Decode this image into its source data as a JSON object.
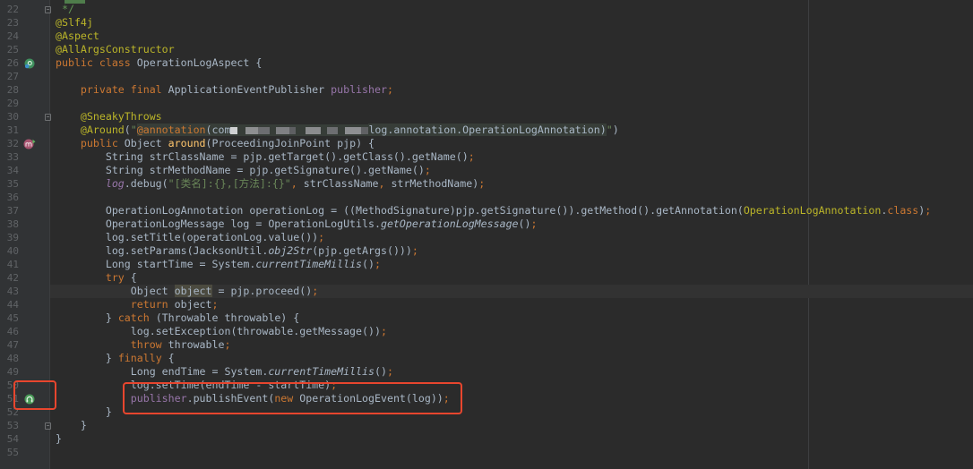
{
  "theme": {
    "bg": "#2B2B2B",
    "gutter_bg": "#313335",
    "text": "#A9B7C6",
    "keyword": "#CC7832",
    "annotation": "#BBB529",
    "string": "#6A8759",
    "field": "#9876AA",
    "method_decl": "#FFC66D",
    "javadoc": "#629755",
    "line_number": "#606366",
    "identifier_highlight": "#4B4A3F",
    "injection_bg": "#373D38",
    "caret_row": "#323232",
    "right_margin": "#3D3F41",
    "fold_marker": "#6E7072",
    "callout": "#E8462E"
  },
  "editor": {
    "caret_line": 43,
    "lines": [
      {
        "n": 22,
        "fold_end": true,
        "tokens": [
          {
            "doc": " */"
          }
        ]
      },
      {
        "n": 23,
        "tokens": [
          {
            "ann": "@Slf4j"
          }
        ]
      },
      {
        "n": 24,
        "tokens": [
          {
            "ann": "@Aspect"
          }
        ]
      },
      {
        "n": 25,
        "tokens": [
          {
            "ann": "@AllArgsConstructor"
          }
        ]
      },
      {
        "n": 26,
        "icon": "aspect-icon",
        "tokens": [
          {
            "kw": "public class "
          },
          {
            "d": "OperationLogAspect {"
          }
        ]
      },
      {
        "n": 27,
        "tokens": []
      },
      {
        "n": 28,
        "tokens": [
          {
            "kw": "    private final "
          },
          {
            "d": "ApplicationEventPublisher "
          },
          {
            "fld": "publisher"
          },
          {
            "kw": ";"
          }
        ]
      },
      {
        "n": 29,
        "tokens": []
      },
      {
        "n": 30,
        "fold_start": true,
        "tokens": [
          {
            "ann": "    @SneakyThrows"
          }
        ]
      },
      {
        "n": 31,
        "tokens": [
          {
            "ann": "    @Around"
          },
          {
            "d": "("
          },
          {
            "str": "\""
          },
          {
            "kw_inj": "@annotation"
          },
          {
            "inj": "(com"
          },
          {
            "redacted": true
          },
          {
            "inj": "log.annotation.OperationLogAnnotation)"
          },
          {
            "str": "\""
          },
          {
            "d": ")"
          }
        ]
      },
      {
        "n": 32,
        "icon": "advice-icon",
        "tokens": [
          {
            "kw": "    public "
          },
          {
            "d": "Object "
          },
          {
            "decl": "around"
          },
          {
            "d": "(ProceedingJoinPoint pjp) {"
          }
        ]
      },
      {
        "n": 33,
        "tokens": [
          {
            "d": "        String strClassName = pjp.getTarget().getClass().getName()"
          },
          {
            "kw": ";"
          }
        ]
      },
      {
        "n": 34,
        "tokens": [
          {
            "d": "        String strMethodName = pjp.getSignature().getName()"
          },
          {
            "kw": ";"
          }
        ]
      },
      {
        "n": 35,
        "tokens": [
          {
            "sfld": "        log"
          },
          {
            "d": ".debug("
          },
          {
            "str": "\"[类名]:{},[方法]:{}\""
          },
          {
            "kw": ", "
          },
          {
            "d": "strClassName"
          },
          {
            "kw": ", "
          },
          {
            "d": "strMethodName)"
          },
          {
            "kw": ";"
          }
        ]
      },
      {
        "n": 36,
        "tokens": []
      },
      {
        "n": 37,
        "tokens": [
          {
            "d": "        OperationLogAnnotation operationLog = ((MethodSignature)pjp.getSignature()).getMethod().getAnnotation("
          },
          {
            "ann": "OperationLogAnnotation"
          },
          {
            "d": "."
          },
          {
            "kw": "class"
          },
          {
            "d": ")"
          },
          {
            "kw": ";"
          }
        ]
      },
      {
        "n": 38,
        "tokens": [
          {
            "d": "        OperationLogMessage log = OperationLogUtils."
          },
          {
            "st": "getOperationLogMessage"
          },
          {
            "d": "()"
          },
          {
            "kw": ";"
          }
        ]
      },
      {
        "n": 39,
        "tokens": [
          {
            "d": "        log.setTitle(operationLog.value())"
          },
          {
            "kw": ";"
          }
        ]
      },
      {
        "n": 40,
        "tokens": [
          {
            "d": "        log.setParams(JacksonUtil."
          },
          {
            "st": "obj2Str"
          },
          {
            "d": "(pjp.getArgs()))"
          },
          {
            "kw": ";"
          }
        ]
      },
      {
        "n": 41,
        "tokens": [
          {
            "d": "        Long startTime = System."
          },
          {
            "st": "currentTimeMillis"
          },
          {
            "d": "()"
          },
          {
            "kw": ";"
          }
        ]
      },
      {
        "n": 42,
        "tokens": [
          {
            "kw": "        try "
          },
          {
            "d": "{"
          }
        ]
      },
      {
        "n": 43,
        "tokens": [
          {
            "d": "            Object "
          },
          {
            "hl": "object"
          },
          {
            "d": " = pjp.proceed()"
          },
          {
            "kw": ";"
          }
        ]
      },
      {
        "n": 44,
        "tokens": [
          {
            "kw": "            return "
          },
          {
            "d": "object"
          },
          {
            "kw": ";"
          }
        ]
      },
      {
        "n": 45,
        "tokens": [
          {
            "d": "        } "
          },
          {
            "kw": "catch "
          },
          {
            "d": "(Throwable throwable) {"
          }
        ]
      },
      {
        "n": 46,
        "tokens": [
          {
            "d": "            log.setException(throwable.getMessage())"
          },
          {
            "kw": ";"
          }
        ]
      },
      {
        "n": 47,
        "tokens": [
          {
            "kw": "            throw "
          },
          {
            "d": "throwable"
          },
          {
            "kw": ";"
          }
        ]
      },
      {
        "n": 48,
        "tokens": [
          {
            "d": "        } "
          },
          {
            "kw": "finally "
          },
          {
            "d": "{"
          }
        ]
      },
      {
        "n": 49,
        "tokens": [
          {
            "d": "            Long endTime = System."
          },
          {
            "st": "currentTimeMillis"
          },
          {
            "d": "()"
          },
          {
            "kw": ";"
          }
        ]
      },
      {
        "n": 50,
        "tokens": [
          {
            "d": "            log.setTime(endTime - startTime)"
          },
          {
            "kw": ";"
          }
        ]
      },
      {
        "n": 51,
        "icon": "event-publisher-icon",
        "tokens": [
          {
            "fld": "            publisher"
          },
          {
            "d": ".publishEvent("
          },
          {
            "kw": "new "
          },
          {
            "d": "OperationLogEvent(log))"
          },
          {
            "kw": ";"
          }
        ]
      },
      {
        "n": 52,
        "tokens": [
          {
            "d": "        }"
          }
        ]
      },
      {
        "n": 53,
        "fold_end": true,
        "tokens": [
          {
            "d": "    }"
          }
        ]
      },
      {
        "n": 54,
        "tokens": [
          {
            "d": "}"
          }
        ]
      },
      {
        "n": 55,
        "tokens": []
      }
    ]
  }
}
